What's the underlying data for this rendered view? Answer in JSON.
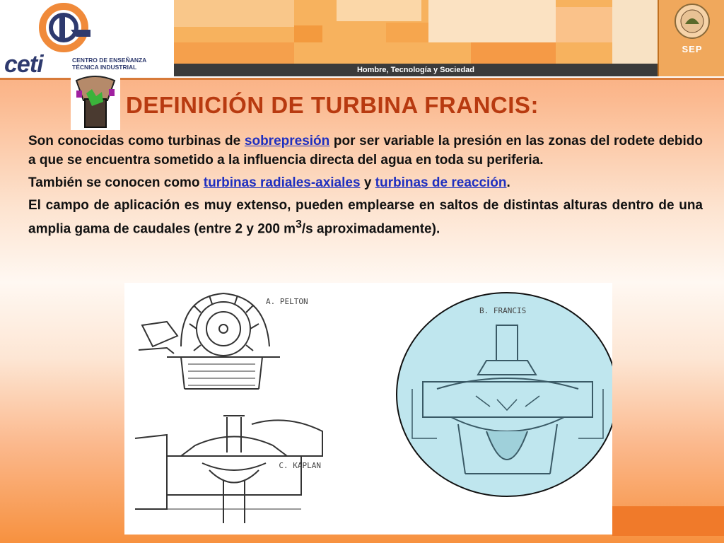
{
  "header": {
    "logo_word": "ceti",
    "logo_subtitle": "CENTRO DE ENSEÑANZA TÉCNICA INDUSTRIAL",
    "tagline": "Hombre, Tecnología y Sociedad",
    "sep_label": "SEP"
  },
  "title": "DEFINICIÓN DE TURBINA FRANCIS:",
  "paragraphs": {
    "p1_before": "Son conocidas como turbinas de ",
    "p1_link": "sobrepresión",
    "p1_after": " por ser variable la presión en las zonas del rodete debido a que se encuentra sometido a la influencia directa del agua en toda su periferia.",
    "p2_before": "También se conocen como ",
    "p2_link1": "turbinas radiales-axiales",
    "p2_mid": " y ",
    "p2_link2": "turbinas de reacción",
    "p2_after": ".",
    "p3_before": "El campo de aplicación es muy extenso, pueden emplearse en saltos de distintas alturas dentro de una amplia gama de caudales (entre 2 y 200 m",
    "p3_sup": "3",
    "p3_after": "/s aproximadamente)."
  },
  "figures": {
    "pelton_label": "A. PELTON",
    "kaplan_label": "C. KAPLAN",
    "francis_label": "B. FRANCIS"
  },
  "colors": {
    "title": "#b83a10",
    "link": "#1f2fbf",
    "francis_tint": "#bfe6ee"
  }
}
